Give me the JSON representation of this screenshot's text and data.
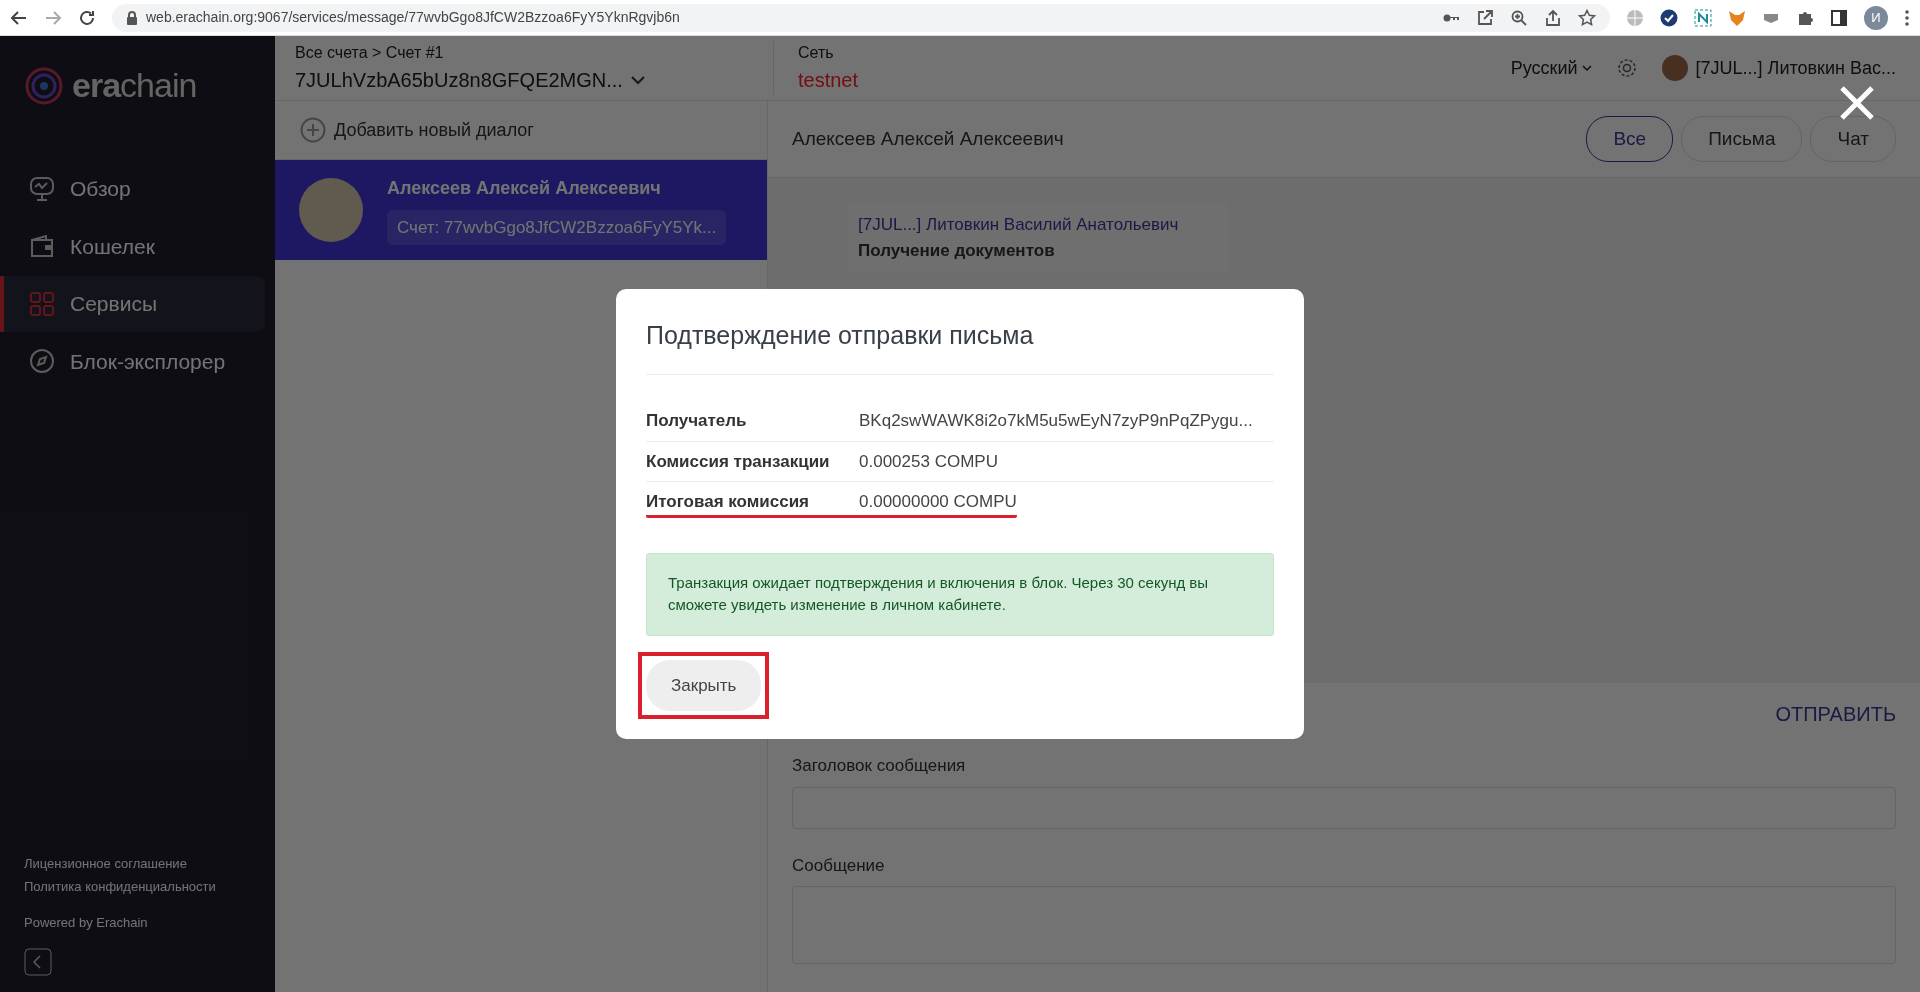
{
  "browser": {
    "url": "web.erachain.org:9067/services/message/77wvbGgo8JfCW2Bzzoa6FyY5YknRgvjb6n",
    "profile_initial": "И"
  },
  "sidebar": {
    "logo": "**era**chain",
    "items": [
      {
        "label": "Обзор",
        "kind": "overview",
        "selected": false
      },
      {
        "label": "Кошелек",
        "kind": "wallet",
        "selected": false
      },
      {
        "label": "Сервисы",
        "kind": "services",
        "selected": true
      },
      {
        "label": "Блок-эксплорер",
        "kind": "explorer",
        "selected": false
      }
    ],
    "footer_links": [
      "Лицензионное соглашение",
      "Политика конфиденциальности"
    ],
    "powered_by": "Powered by Erachain"
  },
  "header": {
    "breadcrumb": "Все счета > Счет #1",
    "account": "7JULhVzbA65bUz8n8GFQE2MGN...",
    "network_label": "Сеть",
    "network": "testnet",
    "language": "Русский",
    "user": "[7JUL...] Литовкин Вас..."
  },
  "dialogs": {
    "add_label": "Добавить новый диалог",
    "items": [
      {
        "name": "Алексеев Алексей Алексеевич",
        "account": "Счет: 77wvbGgo8JfCW2Bzzoa6FyY5Yk...",
        "selected": true
      }
    ]
  },
  "conversation": {
    "title": "Алексеев Алексей Алексеевич",
    "filters": [
      {
        "label": "Все",
        "selected": true
      },
      {
        "label": "Письма",
        "selected": false
      },
      {
        "label": "Чат",
        "selected": false
      }
    ],
    "messages": [
      {
        "sender": "[7JUL...] Литовкин Василий Анатольевич",
        "subject": "Получение документов"
      }
    ],
    "send_label": "ОТПРАВИТЬ",
    "subject_label": "Заголовок сообщения",
    "message_label": "Сообщение"
  },
  "modal": {
    "title": "Подтверждение отправки письма",
    "rows": [
      {
        "label": "Получатель",
        "value": "BKq2swWAWK8i2o7kM5u5wEyN7zyP9nPqZPygu...",
        "underlined": false
      },
      {
        "label": "Комиссия транзакции",
        "value": "0.000253 COMPU",
        "underlined": false
      },
      {
        "label": "Итоговая комиссия",
        "value": "0.00000000 COMPU",
        "underlined": true
      }
    ],
    "alert": "Транзакция ожидает подтверждения и включения в блок. Через 30 секунд вы сможете увидеть изменение в личном кабинете.",
    "close_button": {
      "label": "Закрыть",
      "highlighted": true
    }
  }
}
